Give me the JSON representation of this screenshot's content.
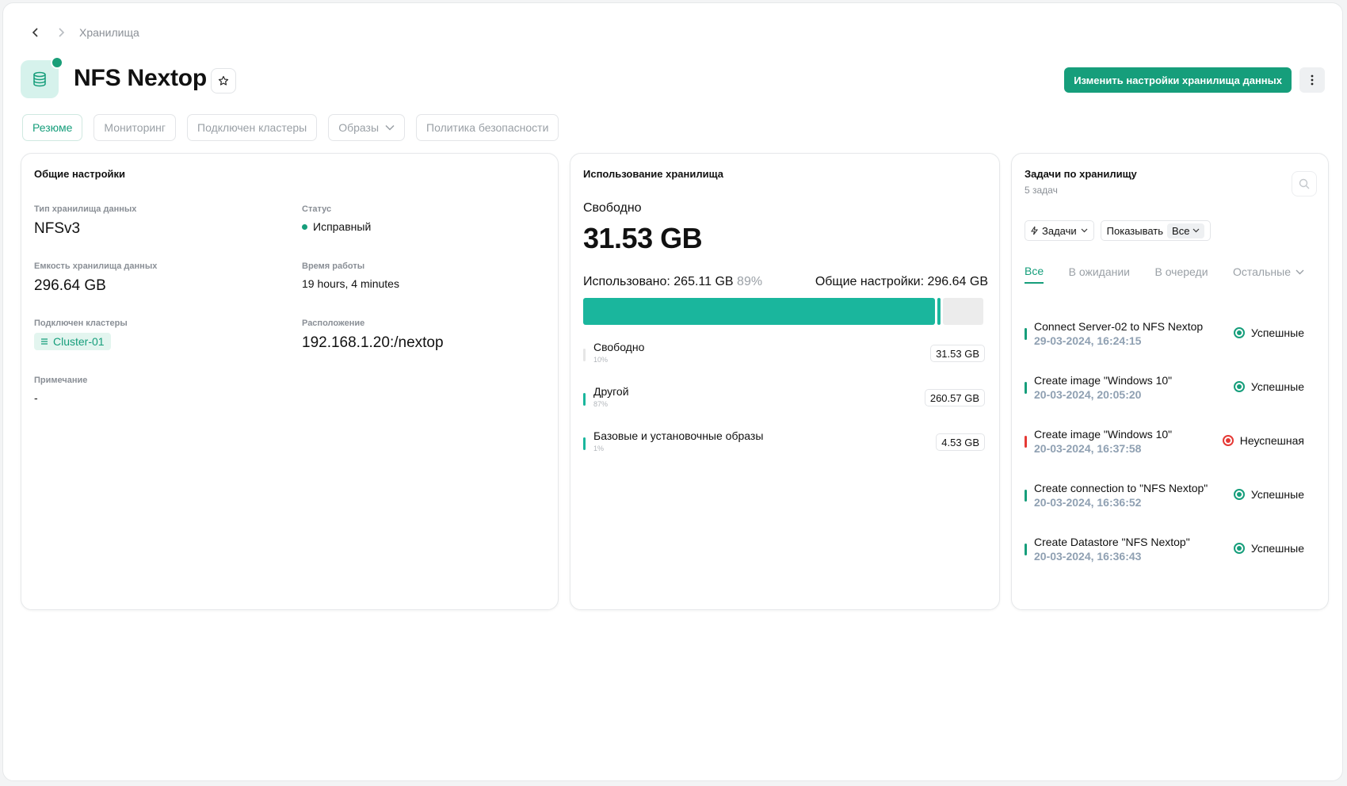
{
  "breadcrumb": {
    "current": "Хранилища"
  },
  "header": {
    "title": "NFS Nextop",
    "primary_button": "Изменить настройки хранилища данных"
  },
  "tabs": [
    {
      "label": "Резюме",
      "active": true
    },
    {
      "label": "Мониторинг"
    },
    {
      "label": "Подключен кластеры"
    },
    {
      "label": "Образы",
      "dropdown": true
    },
    {
      "label": "Политика безопасности"
    }
  ],
  "general": {
    "title": "Общие настройки",
    "type_label": "Тип хранилища данных",
    "type_value": "NFSv3",
    "status_label": "Статус",
    "status_value": "Исправный",
    "capacity_label": "Емкость хранилища данных",
    "capacity_value": "296.64 GB",
    "uptime_label": "Время работы",
    "uptime_value": "19 hours, 4 minutes",
    "clusters_label": "Подключен кластеры",
    "cluster_chip": "Cluster-01",
    "location_label": "Расположение",
    "location_value": "192.168.1.20:/nextop",
    "note_label": "Примечание",
    "note_value": "-"
  },
  "usage": {
    "title": "Использование хранилища",
    "free_label": "Свободно",
    "free_value": "31.53 GB",
    "used_label": "Использовано: 265.11 GB",
    "used_pct": "89%",
    "total_label": "Общие настройки: 296.64 GB",
    "bar": {
      "other_fraction": 0.87,
      "base_fraction": 0.015,
      "free_fraction": 0.11
    },
    "legend": [
      {
        "name": "Свободно",
        "pct": "10%",
        "value": "31.53 GB",
        "color": "#e6e6e6"
      },
      {
        "name": "Другой",
        "pct": "87%",
        "value": "260.57 GB",
        "color": "#1ab69d"
      },
      {
        "name": "Базовые и установочные образы",
        "pct": "1%",
        "value": "4.53 GB",
        "color": "#1ab69d"
      }
    ]
  },
  "tasks": {
    "title": "Задачи по хранилищу",
    "count": "5 задач",
    "filter_tasks": "Задачи",
    "filter_show": "Показывать",
    "filter_show_value": "Все",
    "subtabs": [
      "Все",
      "В ожидании",
      "В очереди",
      "Остальные"
    ],
    "items": [
      {
        "name": "Connect Server-02 to NFS Nextop",
        "date": "29-03-2024, 16:24:15",
        "status": "Успешные",
        "ok": true
      },
      {
        "name": "Create image \"Windows 10\"",
        "date": "20-03-2024, 20:05:20",
        "status": "Успешные",
        "ok": true
      },
      {
        "name": "Create image \"Windows 10\"",
        "date": "20-03-2024, 16:37:58",
        "status": "Неуспешная",
        "ok": false
      },
      {
        "name": "Create connection to \"NFS Nextop\"",
        "date": "20-03-2024, 16:36:52",
        "status": "Успешные",
        "ok": true
      },
      {
        "name": "Create Datastore \"NFS Nextop\"",
        "date": "20-03-2024, 16:36:43",
        "status": "Успешные",
        "ok": true
      }
    ]
  },
  "colors": {
    "accent": "#169e7b",
    "success": "#169e7b",
    "error": "#e53935",
    "bar": "#1ab69d"
  }
}
